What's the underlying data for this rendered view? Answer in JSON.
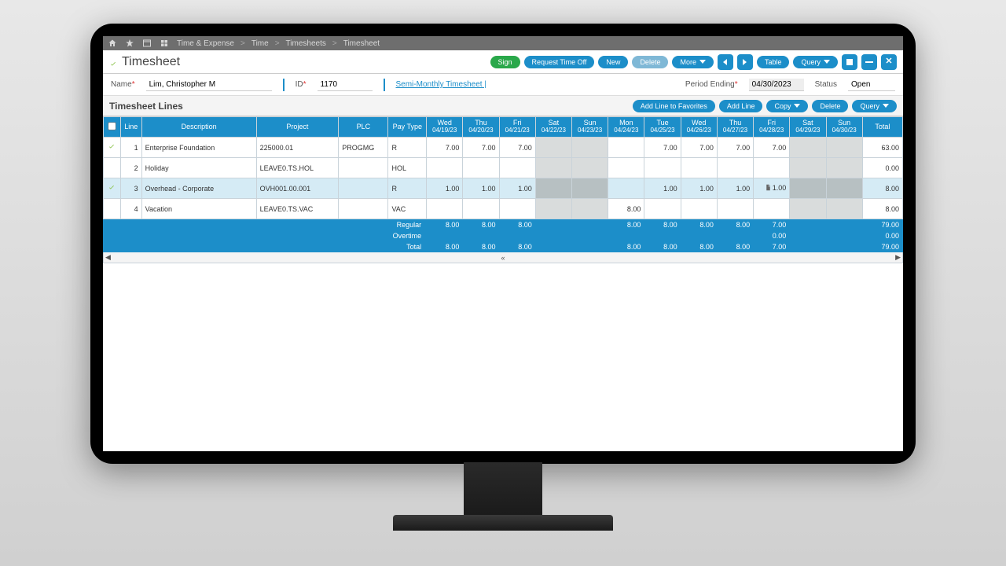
{
  "breadcrumbs": [
    "Time & Expense",
    "Time",
    "Timesheets",
    "Timesheet"
  ],
  "page_title": "Timesheet",
  "toolbar": {
    "sign": "Sign",
    "request": "Request Time Off",
    "new": "New",
    "delete": "Delete",
    "more": "More",
    "table": "Table",
    "query": "Query"
  },
  "fields": {
    "name_label": "Name",
    "name": "Lim, Christopher M",
    "id_label": "ID",
    "id": "1170",
    "link": "Semi-Monthly Timesheet |",
    "period_label": "Period Ending",
    "period": "04/30/2023",
    "status_label": "Status",
    "status": "Open"
  },
  "lines": {
    "title": "Timesheet Lines",
    "btns": {
      "fav": "Add Line to Favorites",
      "add": "Add Line",
      "copy": "Copy",
      "del": "Delete",
      "query": "Query"
    },
    "hdr": {
      "line": "Line",
      "desc": "Description",
      "proj": "Project",
      "plc": "PLC",
      "pay": "Pay Type",
      "total": "Total"
    },
    "days": [
      {
        "dow": "Wed",
        "date": "04/19/23"
      },
      {
        "dow": "Thu",
        "date": "04/20/23"
      },
      {
        "dow": "Fri",
        "date": "04/21/23"
      },
      {
        "dow": "Sat",
        "date": "04/22/23"
      },
      {
        "dow": "Sun",
        "date": "04/23/23"
      },
      {
        "dow": "Mon",
        "date": "04/24/23"
      },
      {
        "dow": "Tue",
        "date": "04/25/23"
      },
      {
        "dow": "Wed",
        "date": "04/26/23"
      },
      {
        "dow": "Thu",
        "date": "04/27/23"
      },
      {
        "dow": "Fri",
        "date": "04/28/23"
      },
      {
        "dow": "Sat",
        "date": "04/29/23"
      },
      {
        "dow": "Sun",
        "date": "04/30/23"
      }
    ],
    "rows": [
      {
        "chk": true,
        "n": "1",
        "desc": "Enterprise Foundation",
        "proj": "225000.01",
        "plc": "PROGMG",
        "pay": "R",
        "cells": [
          "7.00",
          "7.00",
          "7.00",
          "",
          "",
          "",
          "7.00",
          "7.00",
          "7.00",
          "7.00",
          "",
          ""
        ],
        "total": "63.00"
      },
      {
        "chk": false,
        "n": "2",
        "desc": "Holiday",
        "proj": "LEAVE0.TS.HOL",
        "plc": "",
        "pay": "HOL",
        "cells": [
          "",
          "",
          "",
          "",
          "",
          "",
          "",
          "",
          "",
          "",
          "",
          ""
        ],
        "total": "0.00"
      },
      {
        "chk": true,
        "n": "3",
        "desc": "Overhead - Corporate",
        "proj": "OVH001.00.001",
        "plc": "",
        "pay": "R",
        "cells": [
          "1.00",
          "1.00",
          "1.00",
          "",
          "",
          "",
          "1.00",
          "1.00",
          "1.00",
          "1.00",
          "",
          ""
        ],
        "total": "8.00",
        "sel": true,
        "edit": 9,
        "editval": "1.00"
      },
      {
        "chk": false,
        "n": "4",
        "desc": "Vacation",
        "proj": "LEAVE0.TS.VAC",
        "plc": "",
        "pay": "VAC",
        "cells": [
          "",
          "",
          "",
          "",
          "",
          "8.00",
          "",
          "",
          "",
          "",
          "",
          ""
        ],
        "total": "8.00"
      }
    ],
    "footer": {
      "labels": [
        "Regular",
        "Overtime",
        "Total"
      ],
      "reg": [
        "8.00",
        "8.00",
        "8.00",
        "",
        "",
        "8.00",
        "8.00",
        "8.00",
        "8.00",
        "7.00",
        "",
        "",
        "79.00"
      ],
      "ot": [
        "",
        "",
        "",
        "",
        "",
        "",
        "",
        "",
        "",
        "0.00",
        "",
        "",
        "0.00"
      ],
      "tot": [
        "8.00",
        "8.00",
        "8.00",
        "",
        "",
        "8.00",
        "8.00",
        "8.00",
        "8.00",
        "7.00",
        "",
        "",
        "79.00"
      ]
    }
  }
}
